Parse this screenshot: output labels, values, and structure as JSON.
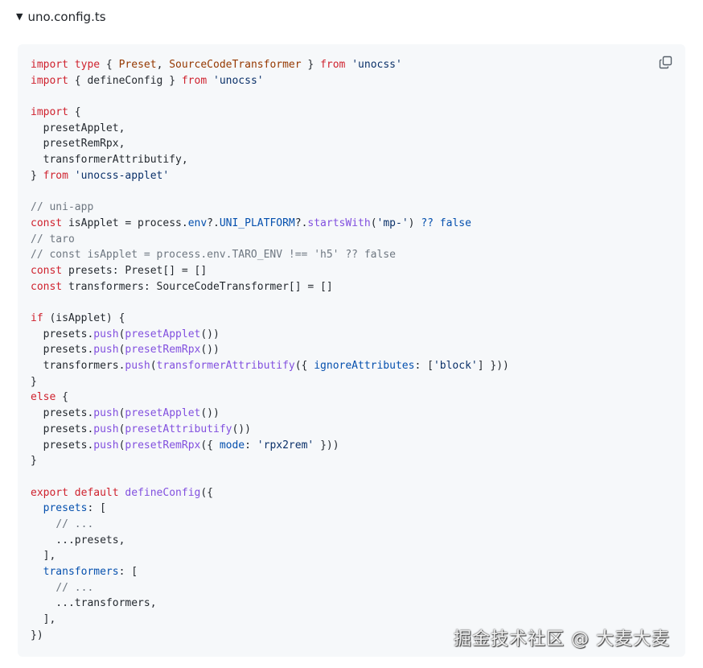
{
  "summary": {
    "filename": "uno.config.ts",
    "toggle_icon": "triangle-down-icon"
  },
  "copy_button": {
    "icon": "copy-icon"
  },
  "colors": {
    "keyword": "#cf222e",
    "type": "#953800",
    "string": "#0a3069",
    "comment": "#6e7781",
    "function": "#8250df",
    "property": "#0550ae",
    "plain": "#24292f",
    "code_background": "#f6f8fa"
  },
  "code": {
    "language": "ts",
    "lines": [
      [
        [
          "keyword",
          "import"
        ],
        [
          "keyword",
          " type"
        ],
        [
          "plain",
          " { "
        ],
        [
          "type",
          "Preset"
        ],
        [
          "plain",
          ", "
        ],
        [
          "type",
          "SourceCodeTransformer"
        ],
        [
          "plain",
          " } "
        ],
        [
          "keyword",
          "from"
        ],
        [
          "plain",
          " "
        ],
        [
          "string",
          "'unocss'"
        ]
      ],
      [
        [
          "keyword",
          "import"
        ],
        [
          "plain",
          " { defineConfig } "
        ],
        [
          "keyword",
          "from"
        ],
        [
          "plain",
          " "
        ],
        [
          "string",
          "'unocss'"
        ]
      ],
      [],
      [
        [
          "keyword",
          "import"
        ],
        [
          "plain",
          " {"
        ]
      ],
      [
        [
          "plain",
          "  presetApplet,"
        ]
      ],
      [
        [
          "plain",
          "  presetRemRpx,"
        ]
      ],
      [
        [
          "plain",
          "  transformerAttributify,"
        ]
      ],
      [
        [
          "plain",
          "} "
        ],
        [
          "keyword",
          "from"
        ],
        [
          "plain",
          " "
        ],
        [
          "string",
          "'unocss-applet'"
        ]
      ],
      [],
      [
        [
          "comment",
          "// uni-app"
        ]
      ],
      [
        [
          "keyword",
          "const"
        ],
        [
          "plain",
          " isApplet = process."
        ],
        [
          "prop",
          "env"
        ],
        [
          "plain",
          "?."
        ],
        [
          "prop",
          "UNI_PLATFORM"
        ],
        [
          "plain",
          "?."
        ],
        [
          "func",
          "startsWith"
        ],
        [
          "plain",
          "("
        ],
        [
          "string",
          "'mp-'"
        ],
        [
          "plain",
          ") "
        ],
        [
          "prop",
          "??"
        ],
        [
          "plain",
          " "
        ],
        [
          "prop",
          "false"
        ]
      ],
      [
        [
          "comment",
          "// taro"
        ]
      ],
      [
        [
          "comment",
          "// const isApplet = process.env.TARO_ENV !== 'h5' ?? false"
        ]
      ],
      [
        [
          "keyword",
          "const"
        ],
        [
          "plain",
          " presets: Preset[] = []"
        ]
      ],
      [
        [
          "keyword",
          "const"
        ],
        [
          "plain",
          " transformers: SourceCodeTransformer[] = []"
        ]
      ],
      [],
      [
        [
          "keyword",
          "if"
        ],
        [
          "plain",
          " (isApplet) {"
        ]
      ],
      [
        [
          "plain",
          "  presets."
        ],
        [
          "func",
          "push"
        ],
        [
          "plain",
          "("
        ],
        [
          "func",
          "presetApplet"
        ],
        [
          "plain",
          "())"
        ]
      ],
      [
        [
          "plain",
          "  presets."
        ],
        [
          "func",
          "push"
        ],
        [
          "plain",
          "("
        ],
        [
          "func",
          "presetRemRpx"
        ],
        [
          "plain",
          "())"
        ]
      ],
      [
        [
          "plain",
          "  transformers."
        ],
        [
          "func",
          "push"
        ],
        [
          "plain",
          "("
        ],
        [
          "func",
          "transformerAttributify"
        ],
        [
          "plain",
          "({ "
        ],
        [
          "prop",
          "ignoreAttributes"
        ],
        [
          "plain",
          ": ["
        ],
        [
          "string",
          "'block'"
        ],
        [
          "plain",
          "] }))"
        ]
      ],
      [
        [
          "plain",
          "}"
        ]
      ],
      [
        [
          "keyword",
          "else"
        ],
        [
          "plain",
          " {"
        ]
      ],
      [
        [
          "plain",
          "  presets."
        ],
        [
          "func",
          "push"
        ],
        [
          "plain",
          "("
        ],
        [
          "func",
          "presetApplet"
        ],
        [
          "plain",
          "())"
        ]
      ],
      [
        [
          "plain",
          "  presets."
        ],
        [
          "func",
          "push"
        ],
        [
          "plain",
          "("
        ],
        [
          "func",
          "presetAttributify"
        ],
        [
          "plain",
          "())"
        ]
      ],
      [
        [
          "plain",
          "  presets."
        ],
        [
          "func",
          "push"
        ],
        [
          "plain",
          "("
        ],
        [
          "func",
          "presetRemRpx"
        ],
        [
          "plain",
          "({ "
        ],
        [
          "prop",
          "mode"
        ],
        [
          "plain",
          ": "
        ],
        [
          "string",
          "'rpx2rem'"
        ],
        [
          "plain",
          " }))"
        ]
      ],
      [
        [
          "plain",
          "}"
        ]
      ],
      [],
      [
        [
          "keyword",
          "export"
        ],
        [
          "keyword",
          " default"
        ],
        [
          "plain",
          " "
        ],
        [
          "func",
          "defineConfig"
        ],
        [
          "plain",
          "({"
        ]
      ],
      [
        [
          "plain",
          "  "
        ],
        [
          "prop",
          "presets"
        ],
        [
          "plain",
          ": ["
        ]
      ],
      [
        [
          "plain",
          "    "
        ],
        [
          "comment",
          "// ..."
        ]
      ],
      [
        [
          "plain",
          "    ...presets,"
        ]
      ],
      [
        [
          "plain",
          "  ],"
        ]
      ],
      [
        [
          "plain",
          "  "
        ],
        [
          "prop",
          "transformers"
        ],
        [
          "plain",
          ": ["
        ]
      ],
      [
        [
          "plain",
          "    "
        ],
        [
          "comment",
          "// ..."
        ]
      ],
      [
        [
          "plain",
          "    ...transformers,"
        ]
      ],
      [
        [
          "plain",
          "  ],"
        ]
      ],
      [
        [
          "plain",
          "})"
        ]
      ]
    ]
  },
  "watermark": {
    "text": "掘金技术社区 @ 大麦大麦"
  }
}
